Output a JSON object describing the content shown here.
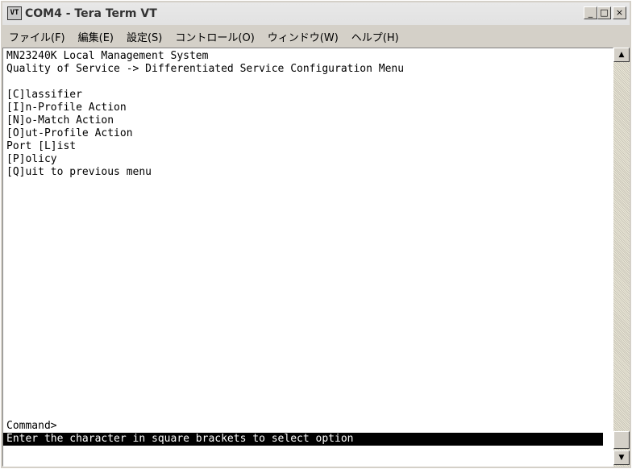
{
  "window": {
    "title": "COM4 - Tera Term VT",
    "icon_label": "VT"
  },
  "title_buttons": {
    "minimize": "_",
    "maximize": "□",
    "close": "×"
  },
  "menu": [
    "ファイル(F)",
    "編集(E)",
    "設定(S)",
    "コントロール(O)",
    "ウィンドウ(W)",
    "ヘルプ(H)"
  ],
  "terminal": {
    "lines": [
      "MN23240K Local Management System",
      "Quality of Service -> Differentiated Service Configuration Menu",
      "",
      "[C]lassifier",
      "[I]n-Profile Action",
      "[N]o-Match Action",
      "[O]ut-Profile Action",
      "Port [L]ist",
      "[P]olicy",
      "[Q]uit to previous menu"
    ],
    "prompt": "Command>",
    "status": "Enter the character in square brackets to select option"
  },
  "scrollbar": {
    "up_arrow": "▲",
    "down_arrow": "▼"
  }
}
